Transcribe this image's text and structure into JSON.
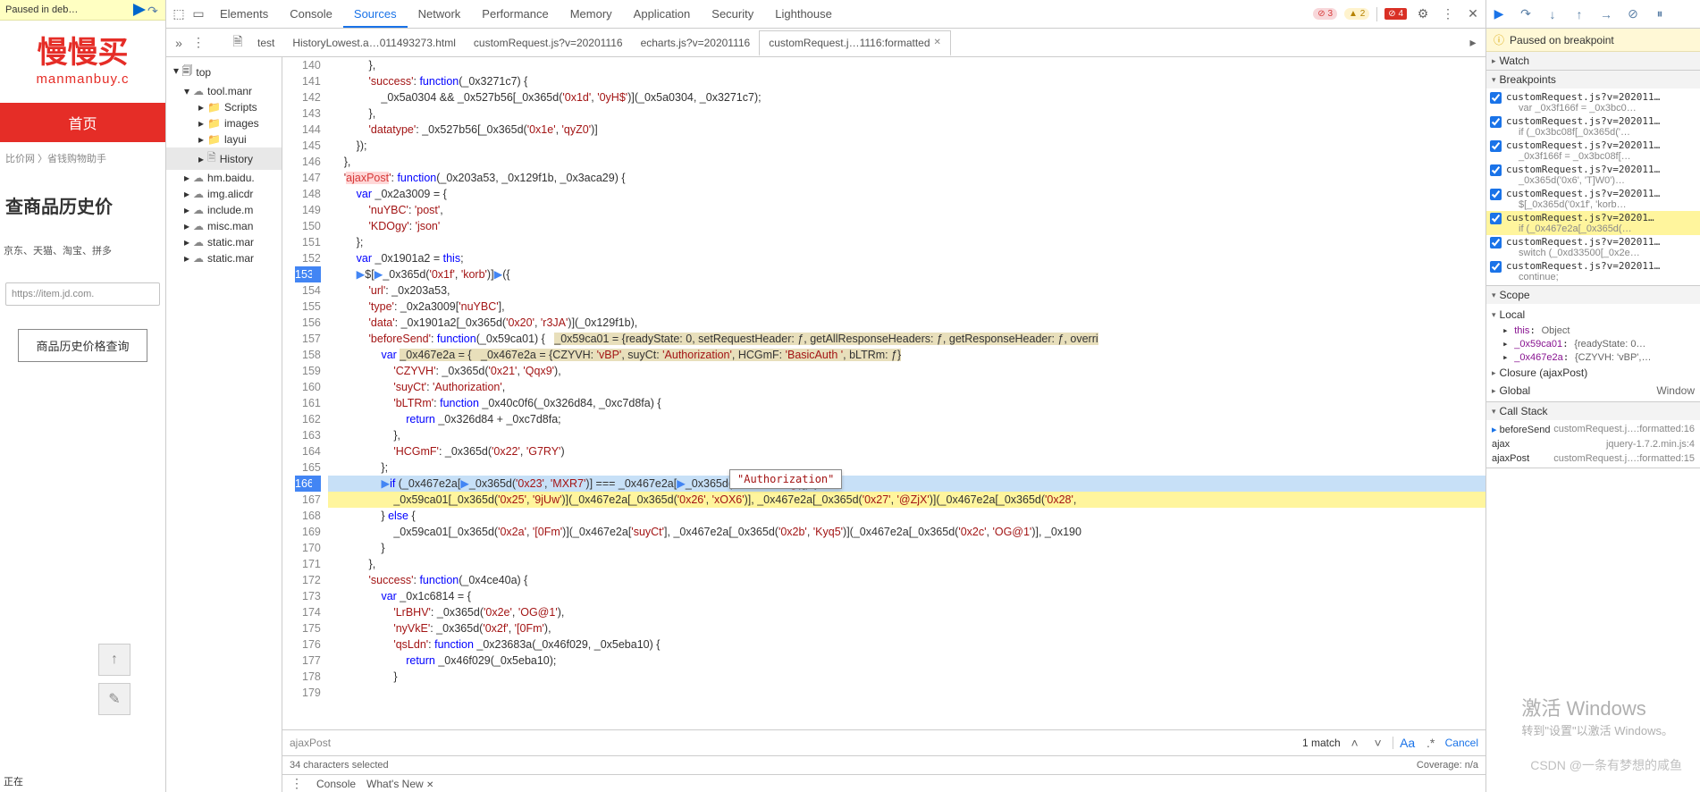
{
  "paused_bar": "Paused in deb…",
  "left_page": {
    "logo_cn": "慢慢买",
    "logo_py": "manmanbuy.c",
    "nav_home": "首页",
    "crumbs": "比价网 〉省钱购物助手",
    "title": "查商品历史价",
    "sites": "京东、天猫、淘宝、拼多",
    "url_ph": "https://item.jd.com.",
    "hist_btn": "商品历史价格查询",
    "bottom": "正在"
  },
  "devtools_tabs": [
    "Elements",
    "Console",
    "Sources",
    "Network",
    "Performance",
    "Memory",
    "Application",
    "Security",
    "Lighthouse"
  ],
  "devtools_active": "Sources",
  "dt_top_errors": "3",
  "dt_top_warns": "2",
  "dt_top_red": "4",
  "file_tabs": [
    {
      "label": "test"
    },
    {
      "label": "HistoryLowest.a…011493273.html"
    },
    {
      "label": "customRequest.js?v=20201116"
    },
    {
      "label": "echarts.js?v=20201116"
    },
    {
      "label": "customRequest.j…1116:formatted",
      "active": true,
      "close": true
    }
  ],
  "tree": {
    "top": "top",
    "items": [
      {
        "label": "tool.manr",
        "icon": "cloud",
        "indent": 1,
        "open": true
      },
      {
        "label": "Scripts",
        "icon": "folder",
        "indent": 2
      },
      {
        "label": "images",
        "icon": "folder",
        "indent": 2
      },
      {
        "label": "layui",
        "icon": "folder",
        "indent": 2
      },
      {
        "label": "History",
        "icon": "file",
        "indent": 2,
        "sel": true
      },
      {
        "label": "hm.baidu.",
        "icon": "cloud",
        "indent": 1
      },
      {
        "label": "img.alicdr",
        "icon": "cloud",
        "indent": 1
      },
      {
        "label": "include.m",
        "icon": "cloud",
        "indent": 1
      },
      {
        "label": "misc.man",
        "icon": "cloud",
        "indent": 1
      },
      {
        "label": "static.mar",
        "icon": "cloud",
        "indent": 1
      },
      {
        "label": "static.mar",
        "icon": "cloud",
        "indent": 1
      }
    ]
  },
  "code": {
    "start": 140,
    "end": 179,
    "bp_line": 153,
    "exec_line": 166,
    "yellow_line": 167,
    "lines": {
      "140": "            },",
      "141": "            'success': function(_0x3271c7) {",
      "142": "                _0x5a0304 && _0x527b56[_0x365d('0x1d', '0yH$')](_0x5a0304, _0x3271c7);",
      "143": "            },",
      "144": "            'datatype': _0x527b56[_0x365d('0x1e', 'qyZ0')]",
      "145": "        });",
      "146": "    },",
      "147": "    'ajaxPost': function(_0x203a53, _0x129f1b, _0x3aca29) {",
      "148": "        var _0x2a3009 = {",
      "149": "            'nuYBC': 'post',",
      "150": "            'KDOgy': 'json'",
      "151": "        };",
      "152": "        var _0x1901a2 = this;",
      "153": "        ▶$[▶_0x365d('0x1f', 'korb')]▶({",
      "154": "            'url': _0x203a53,",
      "155": "            'type': _0x2a3009['nuYBC'],",
      "156": "            'data': _0x1901a2[_0x365d('0x20', 'r3JA')](_0x129f1b),",
      "157": "            'beforeSend': function(_0x59ca01) {   _0x59ca01 = {readyState: 0, setRequestHeader: ƒ, getAllResponseHeaders: ƒ, getResponseHeader: ƒ, overri",
      "158": "                var _0x467e2a = {   _0x467e2a = {CZYVH: 'vBP', suyCt: 'Authorization', HCGmF: 'BasicAuth ', bLTRm: ƒ}",
      "159": "                    'CZYVH': _0x365d('0x21', 'Qqx9'),",
      "160": "                    'suyCt': 'Authorization',",
      "161": "                    'bLTRm': function _0x40c0f6(_0x326d84, _0xc7d8fa) {",
      "162": "                        return _0x326d84 + _0xc7d8fa;",
      "163": "                    },",
      "164": "                    'HCGmF': _0x365d('0x22', 'G7RY')",
      "165": "                };",
      "166": "                ▶if (_0x467e2a[▶_0x365d('0x23', 'MXR7')] === _0x467e2a[▶_0x365d('0x24', 'b5Mg')]) {",
      "167": "                    _0x59ca01[_0x365d('0x25', '9jUw')](_0x467e2a[_0x365d('0x26', 'xOX6')], _0x467e2a[_0x365d('0x27', '@ZjX')](_0x467e2a[_0x365d('0x28',",
      "168": "                } else {",
      "169": "                    _0x59ca01[_0x365d('0x2a', '[0Fm')](_0x467e2a['suyCt'], _0x467e2a[_0x365d('0x2b', 'Kyq5')](_0x467e2a[_0x365d('0x2c', 'OG@1')], _0x190",
      "170": "                }",
      "171": "            },",
      "172": "            'success': function(_0x4ce40a) {",
      "173": "                var _0x1c6814 = {",
      "174": "                    'LrBHV': _0x365d('0x2e', 'OG@1'),",
      "175": "                    'nyVkE': _0x365d('0x2f', '[0Fm'),",
      "176": "                    'qsLdn': function _0x23683a(_0x46f029, _0x5eba10) {",
      "177": "                        return _0x46f029(_0x5eba10);",
      "178": "                    }",
      "179": ""
    },
    "tooltip": "\"Authorization\""
  },
  "search": {
    "query": "ajaxPost",
    "match": "1 match",
    "cancel": "Cancel"
  },
  "status": {
    "sel": "34 characters selected",
    "cov": "Coverage: n/a"
  },
  "drawer": {
    "console": "Console",
    "whatsnew": "What's New"
  },
  "right": {
    "paused": "Paused on breakpoint",
    "watch": "Watch",
    "breakpoints": "Breakpoints",
    "bp_items": [
      {
        "t": "customRequest.js?v=202011…",
        "s": "var _0x3f166f = _0x3bc0…"
      },
      {
        "t": "customRequest.js?v=202011…",
        "s": "if (_0x3bc08f[_0x365d('…"
      },
      {
        "t": "customRequest.js?v=202011…",
        "s": "_0x3f166f = _0x3bc08f[…"
      },
      {
        "t": "customRequest.js?v=202011…",
        "s": "_0x365d('0x6', 'T]W0')…"
      },
      {
        "t": "customRequest.js?v=202011…",
        "s": "$[_0x365d('0x1f', 'korb…"
      },
      {
        "t": "customRequest.js?v=20201…",
        "s": "if (_0x467e2a[_0x365d(…",
        "sel": true
      },
      {
        "t": "customRequest.js?v=202011…",
        "s": "switch (_0xd33500[_0x2e…"
      },
      {
        "t": "customRequest.js?v=202011…",
        "s": "continue;"
      }
    ],
    "scope": "Scope",
    "local": "Local",
    "scope_items": [
      {
        "k": "this",
        "v": "Object"
      },
      {
        "k": "_0x59ca01",
        "v": "{readyState: 0…"
      },
      {
        "k": "_0x467e2a",
        "v": "{CZYVH: 'vBP',…"
      }
    ],
    "closure": "Closure (ajaxPost)",
    "global": "Global",
    "global_val": "Window",
    "callstack": "Call Stack",
    "stack": [
      {
        "n": "beforeSend",
        "loc": "customRequest.j…:formatted:16",
        "cur": true
      },
      {
        "n": "ajax",
        "loc": "jquery-1.7.2.min.js:4"
      },
      {
        "n": "ajaxPost",
        "loc": "customRequest.j…:formatted:15"
      }
    ]
  },
  "watermark": {
    "l1": "激活 Windows",
    "l2": "转到\"设置\"以激活 Windows。"
  },
  "csdn": "CSDN @一条有梦想的咸鱼"
}
